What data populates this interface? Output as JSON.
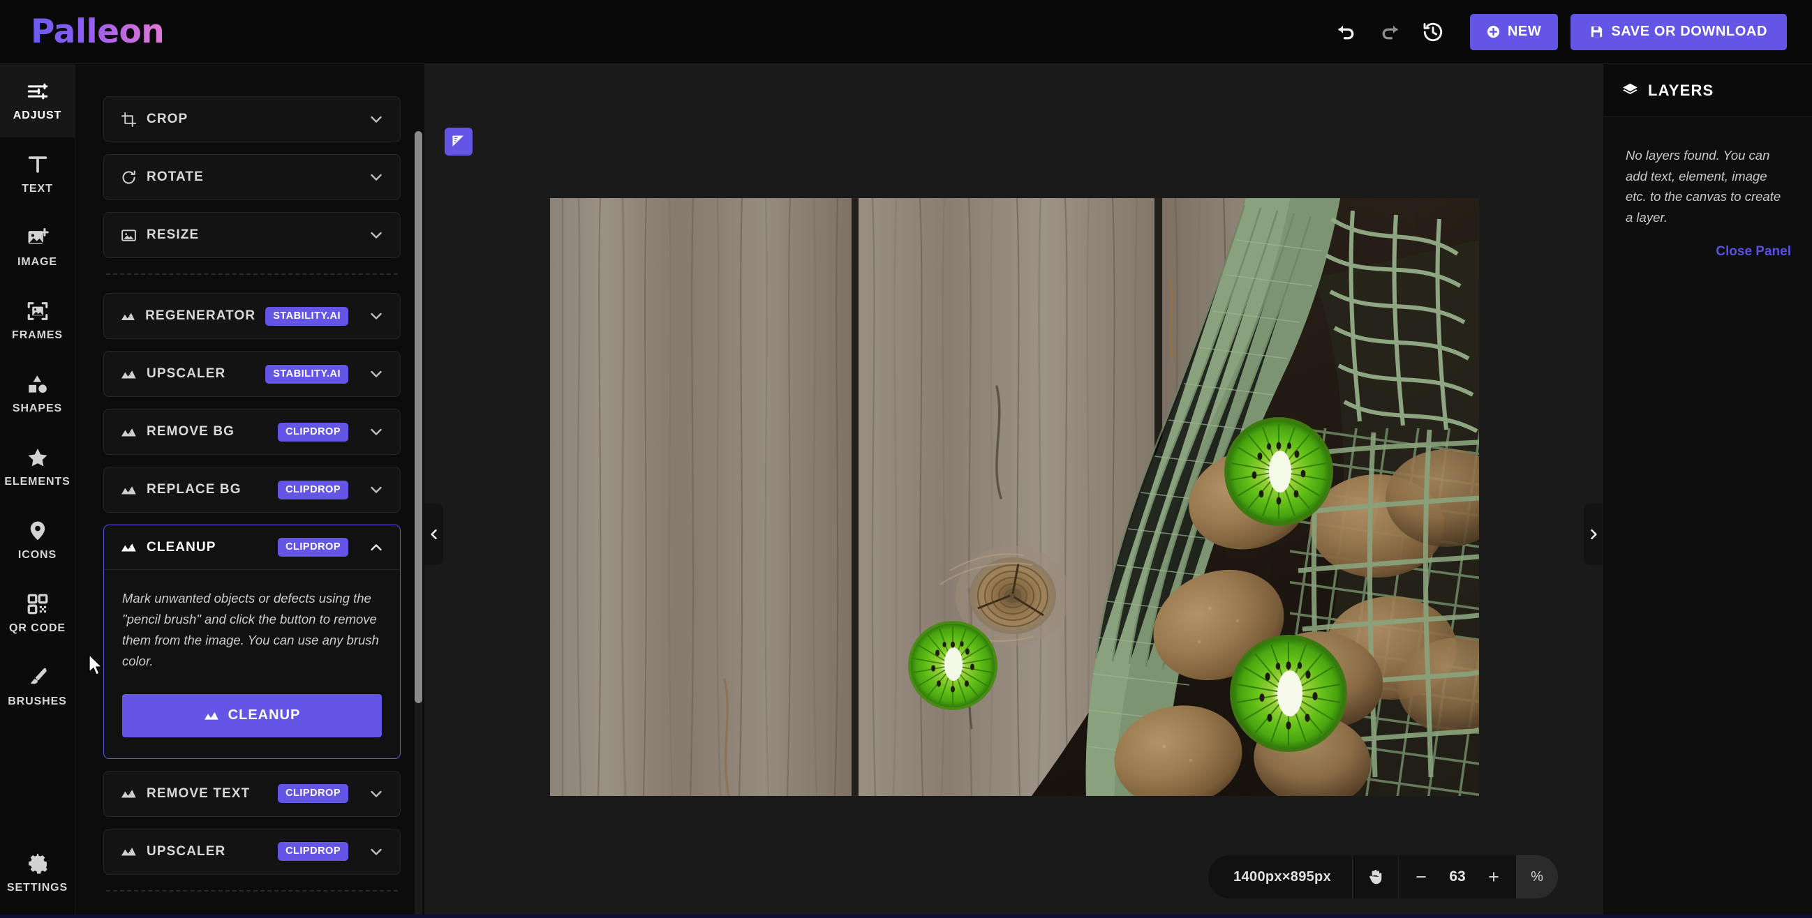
{
  "header": {
    "logo": "Palleon",
    "undo_icon": "undo-icon",
    "redo_icon": "redo-icon",
    "history_icon": "history-icon",
    "new_label": "NEW",
    "save_label": "SAVE OR DOWNLOAD"
  },
  "rail": {
    "items": [
      {
        "label": "ADJUST",
        "icon": "sliders-icon",
        "active": true
      },
      {
        "label": "TEXT",
        "icon": "text-icon",
        "active": false
      },
      {
        "label": "IMAGE",
        "icon": "image-add-icon",
        "active": false
      },
      {
        "label": "FRAMES",
        "icon": "frames-icon",
        "active": false
      },
      {
        "label": "SHAPES",
        "icon": "shapes-icon",
        "active": false
      },
      {
        "label": "ELEMENTS",
        "icon": "star-icon",
        "active": false
      },
      {
        "label": "ICONS",
        "icon": "pin-icon",
        "active": false
      },
      {
        "label": "QR CODE",
        "icon": "qrcode-icon",
        "active": false
      },
      {
        "label": "BRUSHES",
        "icon": "brush-icon",
        "active": false
      }
    ],
    "settings": {
      "label": "SETTINGS",
      "icon": "gear-icon"
    }
  },
  "tools": {
    "groups": [
      {
        "title": "CROP",
        "icon": "crop-icon",
        "badge": "",
        "expanded": false
      },
      {
        "title": "ROTATE",
        "icon": "rotate-icon",
        "badge": "",
        "expanded": false
      },
      {
        "title": "RESIZE",
        "icon": "resize-icon",
        "badge": "",
        "expanded": false
      }
    ],
    "ai_groups": [
      {
        "title": "REGENERATOR",
        "icon": "ai-icon",
        "badge": "STABILITY.AI",
        "expanded": false
      },
      {
        "title": "UPSCALER",
        "icon": "ai-icon",
        "badge": "STABILITY.AI",
        "expanded": false
      },
      {
        "title": "REMOVE BG",
        "icon": "ai-icon",
        "badge": "CLIPDROP",
        "expanded": false
      },
      {
        "title": "REPLACE BG",
        "icon": "ai-icon",
        "badge": "CLIPDROP",
        "expanded": false
      }
    ],
    "cleanup": {
      "title": "CLEANUP",
      "icon": "ai-icon",
      "badge": "CLIPDROP",
      "expanded": true,
      "description": "Mark unwanted objects or defects using the \"pencil brush\" and click the button to remove them from the image. You can use any brush color.",
      "button_label": "CLEANUP"
    },
    "tail_groups": [
      {
        "title": "REMOVE TEXT",
        "icon": "ai-icon",
        "badge": "CLIPDROP",
        "expanded": false
      },
      {
        "title": "UPSCALER",
        "icon": "ai-icon",
        "badge": "CLIPDROP",
        "expanded": false
      }
    ]
  },
  "canvas": {
    "ruler_toggle_icon": "ruler-icon",
    "collapse_left_icon": "chevron-left-icon",
    "collapse_right_icon": "chevron-right-icon",
    "zoom": {
      "dimensions": "1400px×895px",
      "pan_icon": "hand-icon",
      "minus_label": "−",
      "value": "63",
      "plus_label": "+",
      "percent_label": "%"
    }
  },
  "layers": {
    "title": "LAYERS",
    "icon": "layers-icon",
    "empty_message": "No layers found. You can add text, element, image etc. to the canvas to create a layer.",
    "close_label": "Close Panel"
  },
  "colors": {
    "accent": "#6355e5",
    "badge": "#6355e5",
    "link": "#5a4fe0",
    "panel_bg": "#0c0c0c",
    "canvas_bg": "#1a1a1a",
    "header_bg": "#090909"
  }
}
